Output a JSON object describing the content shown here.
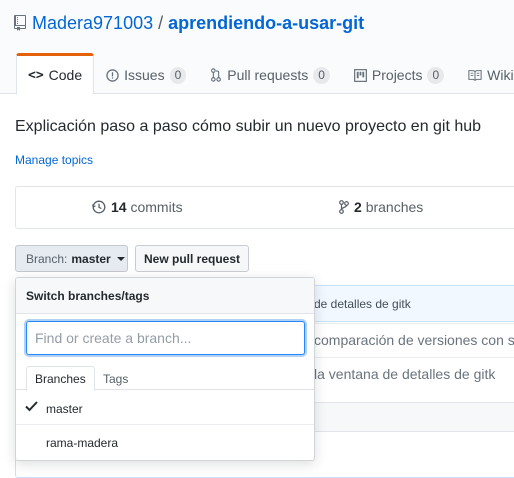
{
  "repo": {
    "owner": "Madera971003",
    "separator": "/",
    "name": "aprendiendo-a-usar-git"
  },
  "tabs": [
    {
      "label": "Code",
      "icon": "code-icon",
      "selected": true
    },
    {
      "label": "Issues",
      "icon": "issue-icon",
      "count": "0"
    },
    {
      "label": "Pull requests",
      "icon": "pull-request-icon",
      "count": "0"
    },
    {
      "label": "Projects",
      "icon": "project-icon",
      "count": "0"
    },
    {
      "label": "Wiki",
      "icon": "book-icon"
    }
  ],
  "description": "Explicación paso a paso cómo subir un nuevo proyecto en git hub",
  "manage_topics": "Manage topics",
  "summary": {
    "commits_count": "14",
    "commits_label": "commits",
    "branches_count": "2",
    "branches_label": "branches"
  },
  "branch_button": {
    "label": "Branch:",
    "value": "master"
  },
  "new_pr_button": "New pull request",
  "background_files": {
    "commit_message": "de detalles de gitk",
    "rows": [
      "comparación de versiones con s",
      "la ventana de detalles de gitk"
    ]
  },
  "branch_menu": {
    "title": "Switch branches/tags",
    "filter_placeholder": "Find or create a branch...",
    "tabs": [
      "Branches",
      "Tags"
    ],
    "items": [
      {
        "label": "master",
        "selected": true
      },
      {
        "label": "rama-madera",
        "selected": false
      }
    ]
  },
  "colors": {
    "link": "#0366d6",
    "selected_tab_accent": "#e36209",
    "focus_border": "#2188ff"
  }
}
